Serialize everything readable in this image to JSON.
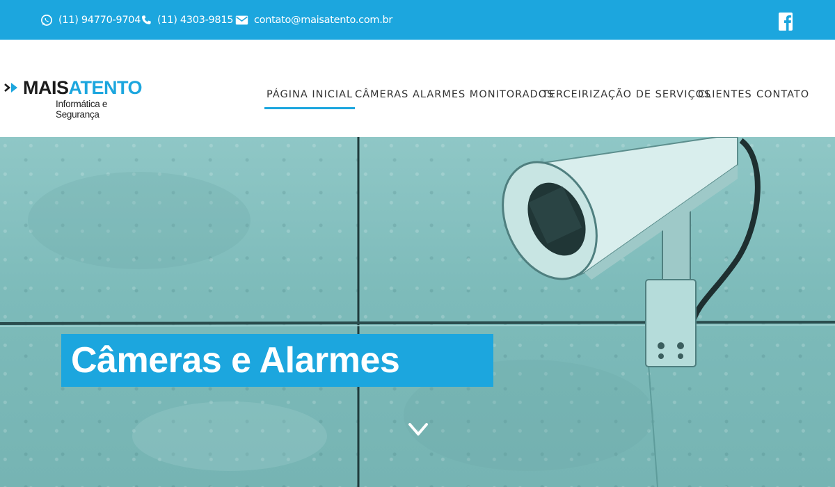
{
  "topbar": {
    "whatsapp": "(11) 94770-9704",
    "phone": "(11) 4303-9815",
    "email": "contato@maisatento.com.br",
    "social_icon": "facebook-icon"
  },
  "logo": {
    "word1": "MAIS",
    "word2": "ATENTO",
    "tagline": "Informática e Segurança"
  },
  "nav": {
    "items": [
      {
        "label": "PÁGINA INICIAL",
        "active": true
      },
      {
        "label": "CÂMERAS",
        "active": false
      },
      {
        "label": "ALARMES MONITORADOS",
        "active": false
      },
      {
        "label": "TERCEIRIZAÇÃO DE SERVIÇOS",
        "active": false
      },
      {
        "label": "CLIENTES",
        "active": false
      },
      {
        "label": "CONTATO",
        "active": false
      }
    ]
  },
  "hero": {
    "title": "Câmeras e Alarmes",
    "scroll_icon": "chevron-down-icon"
  },
  "colors": {
    "accent": "#1ca6de",
    "hero_tint": "#7dbbba",
    "text_dark": "#333333"
  }
}
